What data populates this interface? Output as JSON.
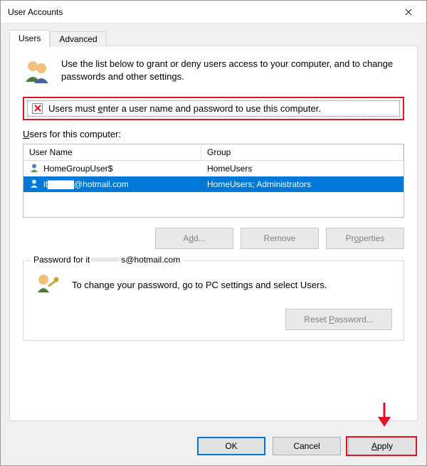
{
  "window": {
    "title": "User Accounts",
    "close_icon": "close-icon"
  },
  "tabs": [
    {
      "label": "Users",
      "active": true
    },
    {
      "label": "Advanced",
      "active": false
    }
  ],
  "intro": "Use the list below to grant or deny users access to your computer, and to change passwords and other settings.",
  "checkbox": {
    "checked_icon": "x-check-icon",
    "label_pre": "Users must ",
    "label_u": "e",
    "label_post": "nter a user name and password to use this computer."
  },
  "list": {
    "label": "Users for this computer:",
    "columns": {
      "name": "User Name",
      "group": "Group"
    },
    "rows": [
      {
        "name": "HomeGroupUser$",
        "group": "HomeUsers",
        "selected": false
      },
      {
        "name": "it▇▇▇▇@hotmail.com",
        "group": "HomeUsers; Administrators",
        "selected": true
      }
    ]
  },
  "buttons": {
    "add": "Add...",
    "remove": "Remove",
    "properties": "Properties"
  },
  "password_group": {
    "legend": "Password for it▇▇▇▇@hotmail.com",
    "text": "To change your password, go to PC settings and select Users.",
    "reset": "Reset Password..."
  },
  "footer": {
    "ok": "OK",
    "cancel": "Cancel",
    "apply": "Apply"
  },
  "annotations": {
    "highlight_checkbox": true,
    "highlight_apply": true
  }
}
